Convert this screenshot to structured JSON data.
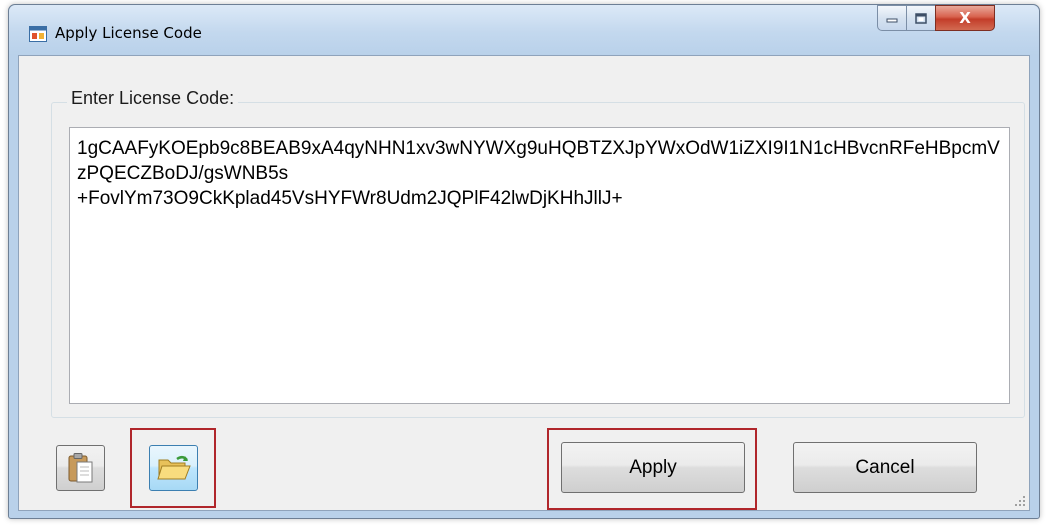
{
  "window": {
    "title": "Apply License Code",
    "close_glyph": "X"
  },
  "license": {
    "group_label": "Enter License Code:",
    "code": "1gCAAFyKOEpb9c8BEAB9xA4qyNHN1xv3wNYWXg9uHQBTZXJpYWxOdW1iZXI9I1N1cHBvcnRFeHBpcmVzPQECZBoDJ/gsWNB5s\n+FovlYm73O9CkKplad45VsHYFWr8Udm2JQPlF42lwDjKHhJllJ+"
  },
  "buttons": {
    "apply": "Apply",
    "cancel": "Cancel"
  },
  "icons": {
    "app": "app-window-icon",
    "paste": "clipboard-icon",
    "open": "folder-open-icon",
    "minimize": "minimize-icon",
    "maximize": "maximize-icon",
    "close": "close-icon"
  },
  "colors": {
    "highlight": "#b0262b",
    "close_button": "#c33d29",
    "open_button": "#bee6fd"
  }
}
